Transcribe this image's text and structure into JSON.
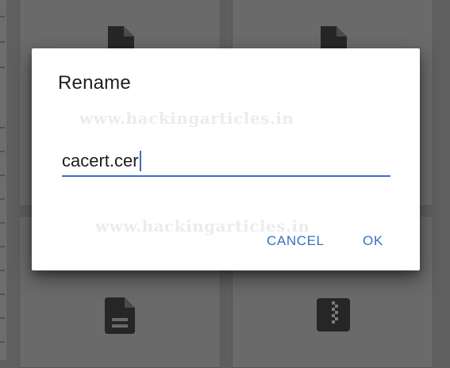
{
  "dialog": {
    "title": "Rename",
    "input_value": "cacert.cer",
    "cancel_label": "CANCEL",
    "ok_label": "OK"
  },
  "watermark": {
    "text_top": "www.hackingarticles.in",
    "text_bottom": "www.hackingarticles.in"
  },
  "background": {
    "icons": [
      "file-icon",
      "file-icon",
      "document-icon",
      "zip-file-icon"
    ]
  },
  "colors": {
    "accent": "#3a6fc7",
    "scrim": "#5f5f5f",
    "dialog_bg": "#ffffff"
  }
}
